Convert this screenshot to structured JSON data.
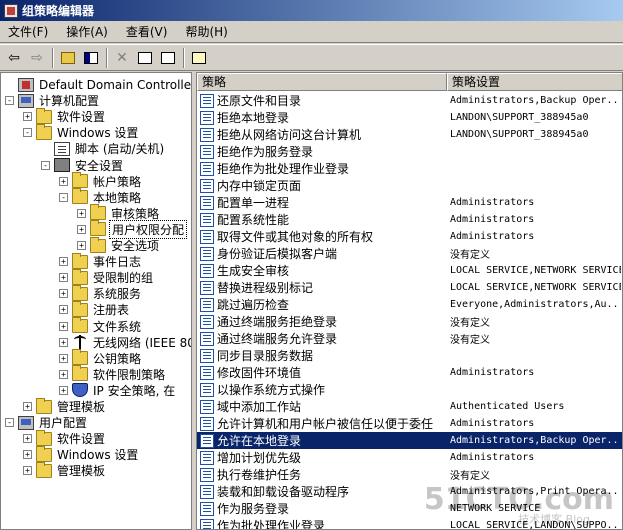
{
  "window": {
    "title": "组策略编辑器"
  },
  "menu": [
    "文件(F)",
    "操作(A)",
    "查看(V)",
    "帮助(H)"
  ],
  "toolbar": {
    "icons": [
      "back-arrow-icon",
      "forward-arrow-icon",
      "up-folder-icon",
      "show-hide-tree-icon",
      "delete-icon",
      "properties-icon",
      "export-list-icon",
      "help-icon"
    ]
  },
  "tree": [
    {
      "label": "Default Domain Controllers P",
      "icon": "root",
      "depth": 0,
      "exp": ""
    },
    {
      "label": "计算机配置",
      "icon": "computer",
      "depth": 0,
      "exp": "-"
    },
    {
      "label": "软件设置",
      "icon": "folder",
      "depth": 1,
      "exp": "+"
    },
    {
      "label": "Windows 设置",
      "icon": "folder",
      "depth": 1,
      "exp": "-"
    },
    {
      "label": "脚本 (启动/关机)",
      "icon": "policy",
      "depth": 2,
      "exp": ""
    },
    {
      "label": "安全设置",
      "icon": "security",
      "depth": 2,
      "exp": "-"
    },
    {
      "label": "帐户策略",
      "icon": "folder",
      "depth": 3,
      "exp": "+"
    },
    {
      "label": "本地策略",
      "icon": "folder",
      "depth": 3,
      "exp": "-"
    },
    {
      "label": "审核策略",
      "icon": "folder",
      "depth": 4,
      "exp": "+"
    },
    {
      "label": "用户权限分配",
      "icon": "folder",
      "depth": 4,
      "exp": "+",
      "selected": true
    },
    {
      "label": "安全选项",
      "icon": "folder",
      "depth": 4,
      "exp": "+"
    },
    {
      "label": "事件日志",
      "icon": "folder",
      "depth": 3,
      "exp": "+"
    },
    {
      "label": "受限制的组",
      "icon": "folder",
      "depth": 3,
      "exp": "+"
    },
    {
      "label": "系统服务",
      "icon": "folder",
      "depth": 3,
      "exp": "+"
    },
    {
      "label": "注册表",
      "icon": "folder",
      "depth": 3,
      "exp": "+"
    },
    {
      "label": "文件系统",
      "icon": "folder",
      "depth": 3,
      "exp": "+"
    },
    {
      "label": "无线网络 (IEEE 80",
      "icon": "antenna",
      "depth": 3,
      "exp": "+"
    },
    {
      "label": "公钥策略",
      "icon": "folder",
      "depth": 3,
      "exp": "+"
    },
    {
      "label": "软件限制策略",
      "icon": "folder",
      "depth": 3,
      "exp": "+"
    },
    {
      "label": "IP 安全策略, 在",
      "icon": "shield",
      "depth": 3,
      "exp": "+"
    },
    {
      "label": "管理模板",
      "icon": "folder",
      "depth": 1,
      "exp": "+"
    },
    {
      "label": "用户配置",
      "icon": "computer",
      "depth": 0,
      "exp": "-"
    },
    {
      "label": "软件设置",
      "icon": "folder",
      "depth": 1,
      "exp": "+"
    },
    {
      "label": "Windows 设置",
      "icon": "folder",
      "depth": 1,
      "exp": "+"
    },
    {
      "label": "管理模板",
      "icon": "folder",
      "depth": 1,
      "exp": "+"
    }
  ],
  "list": {
    "columns": [
      "策略",
      "策略设置"
    ],
    "rows": [
      {
        "name": "还原文件和目录",
        "setting": "Administrators,Backup Oper..."
      },
      {
        "name": "拒绝本地登录",
        "setting": "LANDON\\SUPPORT_388945a0"
      },
      {
        "name": "拒绝从网络访问这台计算机",
        "setting": "LANDON\\SUPPORT_388945a0"
      },
      {
        "name": "拒绝作为服务登录",
        "setting": ""
      },
      {
        "name": "拒绝作为批处理作业登录",
        "setting": ""
      },
      {
        "name": "内存中锁定页面",
        "setting": ""
      },
      {
        "name": "配置单一进程",
        "setting": "Administrators"
      },
      {
        "name": "配置系统性能",
        "setting": "Administrators"
      },
      {
        "name": "取得文件或其他对象的所有权",
        "setting": "Administrators"
      },
      {
        "name": "身份验证后模拟客户端",
        "setting": "没有定义"
      },
      {
        "name": "生成安全审核",
        "setting": "LOCAL SERVICE,NETWORK SERVICE"
      },
      {
        "name": "替换进程级别标记",
        "setting": "LOCAL SERVICE,NETWORK SERVICE"
      },
      {
        "name": "跳过遍历检查",
        "setting": "Everyone,Administrators,Au..."
      },
      {
        "name": "通过终端服务拒绝登录",
        "setting": "没有定义"
      },
      {
        "name": "通过终端服务允许登录",
        "setting": "没有定义"
      },
      {
        "name": "同步目录服务数据",
        "setting": ""
      },
      {
        "name": "修改固件环境值",
        "setting": "Administrators"
      },
      {
        "name": "以操作系统方式操作",
        "setting": ""
      },
      {
        "name": "域中添加工作站",
        "setting": "Authenticated Users"
      },
      {
        "name": "允许计算机和用户帐户被信任以便于委任",
        "setting": "Administrators"
      },
      {
        "name": "允许在本地登录",
        "setting": "Administrators,Backup Oper...",
        "selected": true
      },
      {
        "name": "增加计划优先级",
        "setting": "Administrators"
      },
      {
        "name": "执行卷维护任务",
        "setting": "没有定义"
      },
      {
        "name": "装载和卸载设备驱动程序",
        "setting": "Administrators,Print Opera..."
      },
      {
        "name": "作为服务登录",
        "setting": "NETWORK SERVICE"
      },
      {
        "name": "作为批处理作业登录",
        "setting": "LOCAL SERVICE,LANDON\\SUPPO..."
      }
    ]
  },
  "watermark": {
    "main": "51CTO.com",
    "sub": "技术博客 Blog"
  }
}
